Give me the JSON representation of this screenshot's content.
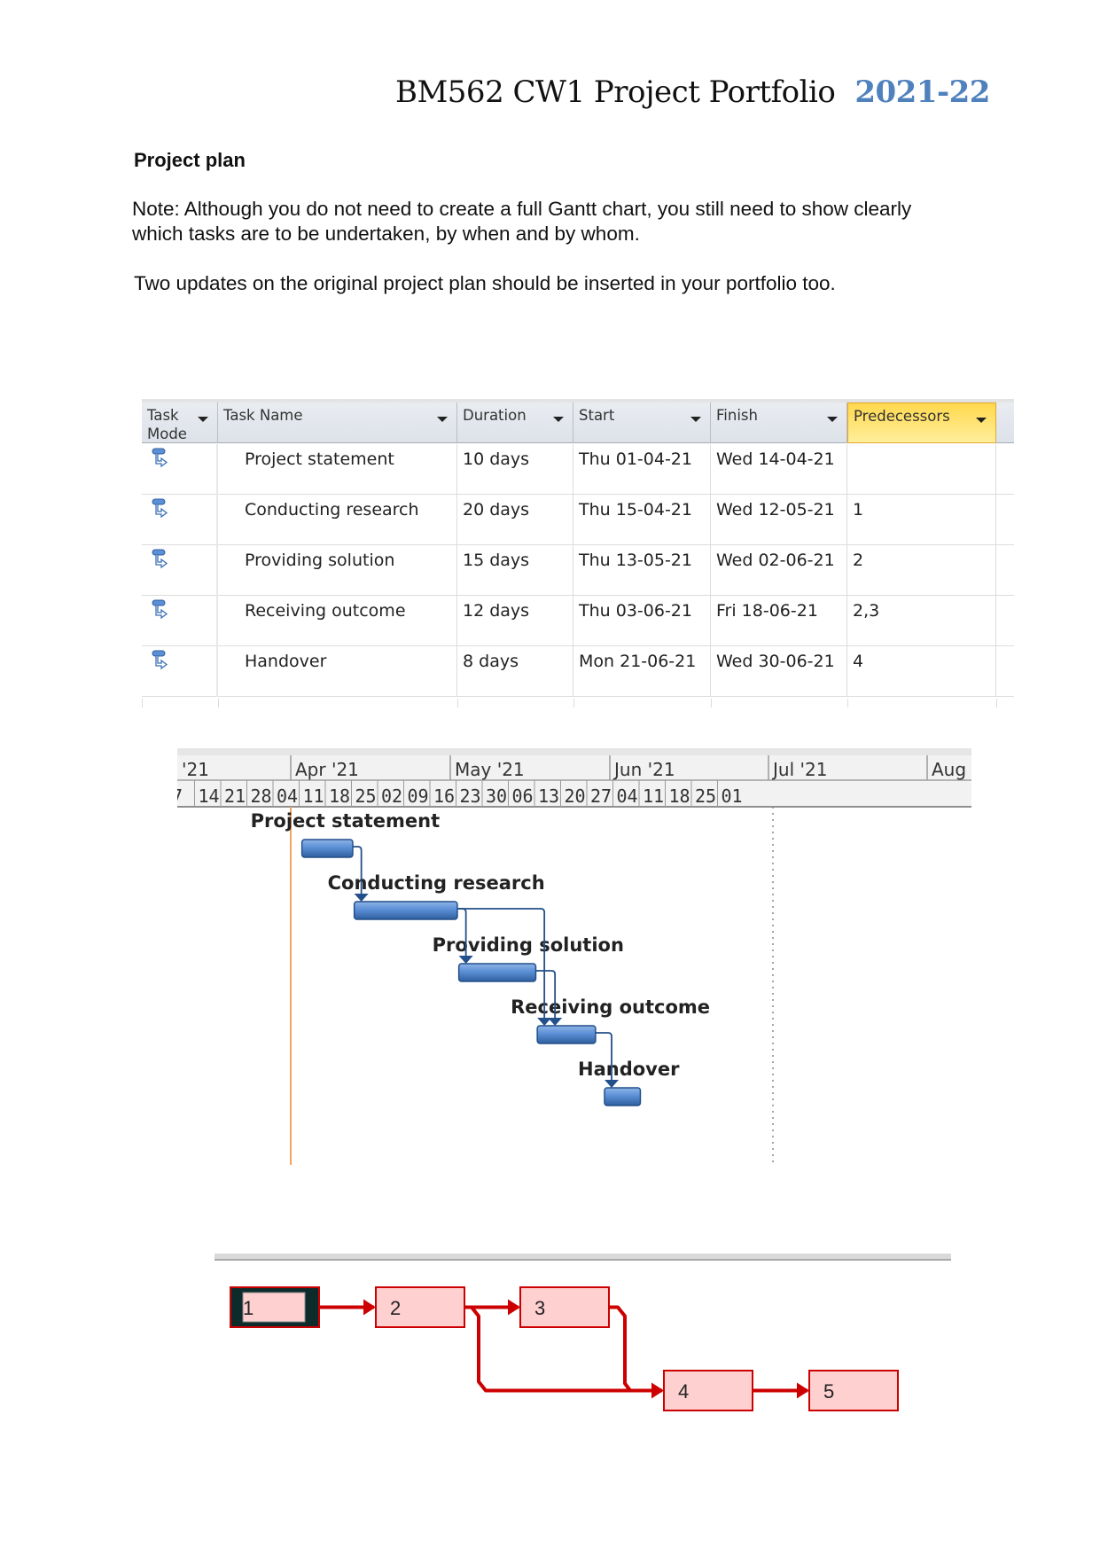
{
  "header": {
    "title": "BM562 CW1 Project Portfolio",
    "year": "2021-22",
    "year_color": "#4f81bd"
  },
  "section": {
    "heading": "Project plan",
    "note": "Note: Although you do not need to create a full Gantt chart, you still need to show clearly which tasks are to be undertaken, by when and by whom.",
    "updates": "Two updates on the original project plan should be inserted in your portfolio too."
  },
  "task_table": {
    "columns": [
      "Task Mode",
      "Task Name",
      "Duration",
      "Start",
      "Finish",
      "Predecessors"
    ],
    "highlighted_column": "Predecessors",
    "mode_icon": "auto-scheduled-task-icon",
    "rows": [
      {
        "id": 1,
        "name": "Project statement",
        "duration": "10 days",
        "start": "Thu 01-04-21",
        "finish": "Wed 14-04-21",
        "predecessors": ""
      },
      {
        "id": 2,
        "name": "Conducting research",
        "duration": "20 days",
        "start": "Thu 15-04-21",
        "finish": "Wed 12-05-21",
        "predecessors": "1"
      },
      {
        "id": 3,
        "name": "Providing solution",
        "duration": "15 days",
        "start": "Thu 13-05-21",
        "finish": "Wed 02-06-21",
        "predecessors": "2"
      },
      {
        "id": 4,
        "name": "Receiving outcome",
        "duration": "12 days",
        "start": "Thu 03-06-21",
        "finish": "Fri 18-06-21",
        "predecessors": "2,3"
      },
      {
        "id": 5,
        "name": "Handover",
        "duration": "8 days",
        "start": "Mon 21-06-21",
        "finish": "Wed 30-06-21",
        "predecessors": "4"
      }
    ]
  },
  "chart_data": {
    "type": "gantt",
    "title": "",
    "timescale": {
      "months": [
        "'21",
        "Apr '21",
        "May '21",
        "Jun '21",
        "Jul '21",
        "Aug"
      ],
      "weeks": [
        "7",
        "14",
        "21",
        "28",
        "04",
        "11",
        "18",
        "25",
        "02",
        "09",
        "16",
        "23",
        "30",
        "06",
        "13",
        "20",
        "27",
        "04",
        "11",
        "18",
        "25",
        "01"
      ],
      "range": [
        "2021-03-07",
        "2021-08-07"
      ]
    },
    "tasks": [
      {
        "id": 1,
        "label": "Project statement",
        "start": "2021-04-01",
        "end": "2021-04-14",
        "predecessors": []
      },
      {
        "id": 2,
        "label": "Conducting research",
        "start": "2021-04-15",
        "end": "2021-05-12",
        "predecessors": [
          1
        ]
      },
      {
        "id": 3,
        "label": "Providing solution",
        "start": "2021-05-13",
        "end": "2021-06-02",
        "predecessors": [
          2
        ]
      },
      {
        "id": 4,
        "label": "Receiving outcome",
        "start": "2021-06-03",
        "end": "2021-06-18",
        "predecessors": [
          2,
          3
        ]
      },
      {
        "id": 5,
        "label": "Handover",
        "start": "2021-06-21",
        "end": "2021-06-30",
        "predecessors": [
          4
        ]
      }
    ],
    "markers": [
      {
        "kind": "project-start",
        "date": "2021-03-31",
        "color": "#f4a460"
      },
      {
        "kind": "project-finish",
        "date": "2021-06-30",
        "style": "dotted"
      }
    ],
    "bar_color": "#4f81bd"
  },
  "network": {
    "nodes": [
      {
        "id": "1",
        "selected": true
      },
      {
        "id": "2",
        "selected": false
      },
      {
        "id": "3",
        "selected": false
      },
      {
        "id": "4",
        "selected": false
      },
      {
        "id": "5",
        "selected": false
      }
    ],
    "links": [
      [
        "1",
        "2"
      ],
      [
        "2",
        "3"
      ],
      [
        "2",
        "4"
      ],
      [
        "3",
        "4"
      ],
      [
        "4",
        "5"
      ]
    ],
    "critical_color": "#cc0000",
    "node_fill": "#ffd0d0"
  }
}
